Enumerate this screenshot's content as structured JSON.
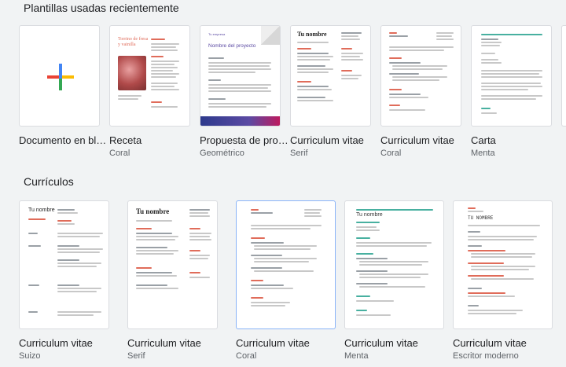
{
  "recent": {
    "title": "Plantillas usadas recientemente",
    "items": [
      {
        "name": "Documento en blanco",
        "sub": ""
      },
      {
        "name": "Receta",
        "sub": "Coral"
      },
      {
        "name": "Propuesta de proyecto",
        "sub": "Geométrico"
      },
      {
        "name": "Curriculum vitae",
        "sub": "Serif"
      },
      {
        "name": "Curriculum vitae",
        "sub": "Coral"
      },
      {
        "name": "Carta",
        "sub": "Menta"
      }
    ]
  },
  "resumes": {
    "title": "Currículos",
    "items": [
      {
        "name": "Curriculum vitae",
        "sub": "Suizo"
      },
      {
        "name": "Curriculum vitae",
        "sub": "Serif"
      },
      {
        "name": "Curriculum vitae",
        "sub": "Coral"
      },
      {
        "name": "Curriculum vitae",
        "sub": "Menta"
      },
      {
        "name": "Curriculum vitae",
        "sub": "Escritor moderno"
      }
    ]
  },
  "thumb_text": {
    "recipe_title": "Torrino de fresa y vainilla",
    "proposal_company": "Tu empresa",
    "proposal_title": "Nombre del proyecto",
    "serif_name": "Tu nombre",
    "swiss_name": "Tu nombre",
    "mint_name": "Tu nombre",
    "modern_name": "TU NOMBRE"
  },
  "colors": {
    "coral": "#e06c5a",
    "teal": "#48b0a0",
    "purple": "#5b4aa3",
    "plus_blue": "#4285f4",
    "plus_red": "#ea4335",
    "plus_yellow": "#fbbc04",
    "plus_green": "#34a853"
  }
}
